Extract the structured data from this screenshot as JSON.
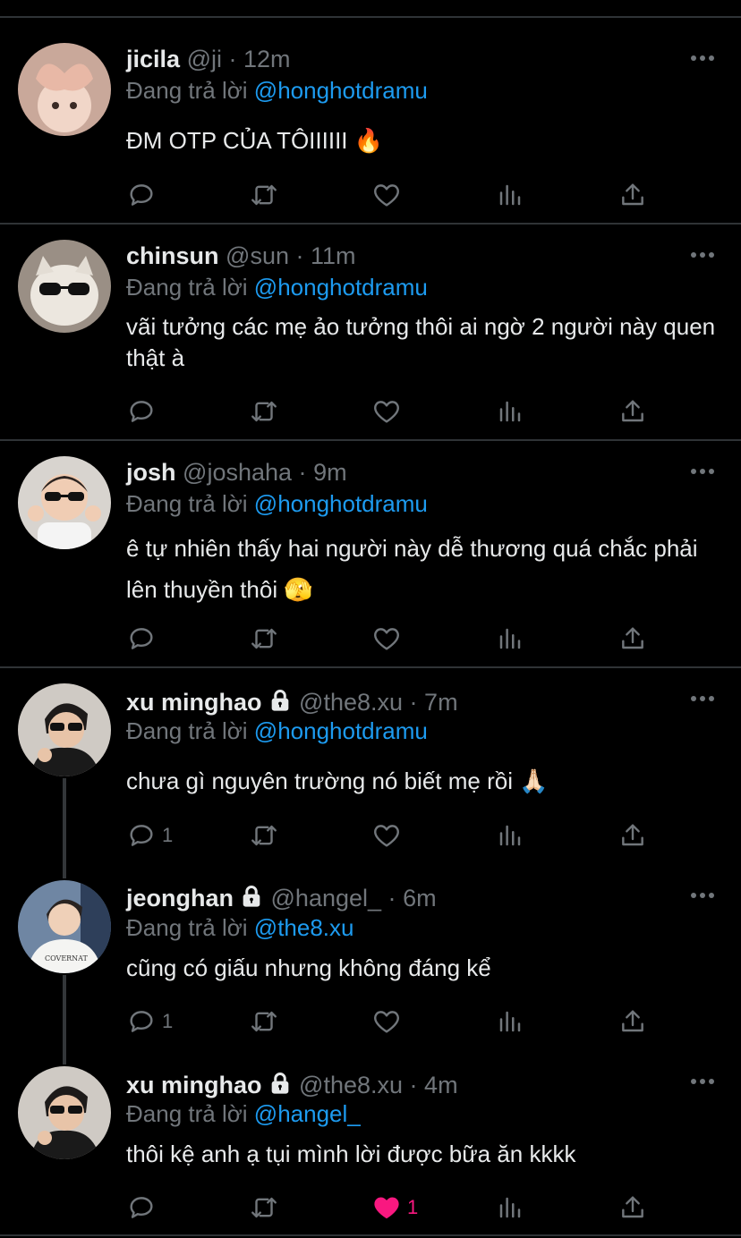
{
  "tweets": [
    {
      "name": "jicila",
      "handle": "@ji",
      "time": "12m",
      "locked": false,
      "replying_label": "Đang trả lời",
      "replying_to": "@honghotdramu",
      "text": "ĐM OTP CỦA TÔIIIIII 🔥",
      "avatar_icon": "heart-hands-child-avatar",
      "replies": "",
      "likes": "",
      "liked": false
    },
    {
      "name": "chinsun",
      "handle": "@sun",
      "time": "11m",
      "locked": false,
      "replying_label": "Đang trả lời",
      "replying_to": "@honghotdramu",
      "text": "vãi tưởng các mẹ ảo tưởng thôi ai ngờ 2 người này quen thật à",
      "avatar_icon": "cat-sunglasses-avatar",
      "replies": "",
      "likes": "",
      "liked": false
    },
    {
      "name": "josh",
      "handle": "@joshaha",
      "time": "9m",
      "locked": false,
      "replying_label": "Đang trả lời",
      "replying_to": "@honghotdramu",
      "text": "ê tự nhiên thấy hai người này dễ thương quá chắc phải lên thuyền thôi 🫣",
      "avatar_icon": "baby-sunglasses-avatar",
      "replies": "",
      "likes": "",
      "liked": false
    },
    {
      "name": "xu minghao",
      "handle": "@the8.xu",
      "time": "7m",
      "locked": true,
      "replying_label": "Đang trả lời",
      "replying_to": "@honghotdramu",
      "text": "chưa gì nguyên trường nó biết mẹ rồi 🙏🏻",
      "avatar_icon": "man-sunglasses-avatar",
      "replies": "1",
      "likes": "",
      "liked": false
    },
    {
      "name": "jeonghan",
      "handle": "@hangel_",
      "time": "6m",
      "locked": true,
      "replying_label": "Đang trả lời",
      "replying_to": "@the8.xu",
      "text": "cũng có giấu nhưng không đáng kể",
      "avatar_icon": "man-white-shirt-avatar",
      "replies": "1",
      "likes": "",
      "liked": false
    },
    {
      "name": "xu minghao",
      "handle": "@the8.xu",
      "time": "4m",
      "locked": true,
      "replying_label": "Đang trả lời",
      "replying_to": "@hangel_",
      "text": "thôi kệ anh ạ tụi mình lời được bữa ăn kkkk",
      "avatar_icon": "man-sunglasses-avatar",
      "replies": "",
      "likes": "1",
      "liked": true
    }
  ],
  "separator": "·",
  "colors": {
    "background": "#000000",
    "text": "#e7e9ea",
    "muted": "#71767b",
    "mention": "#1d9bf0",
    "like": "#f91880",
    "divider": "#2f3336"
  }
}
